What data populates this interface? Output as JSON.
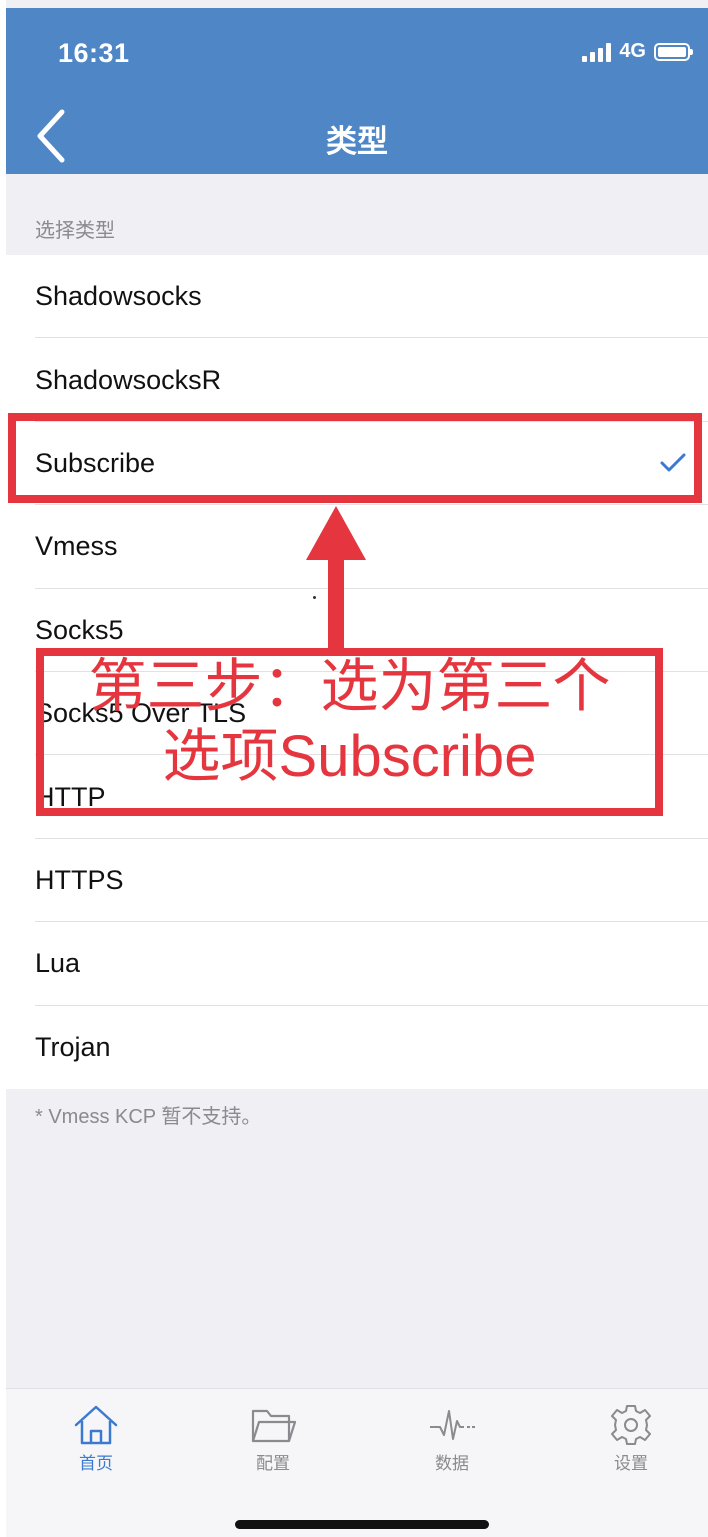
{
  "status_bar": {
    "time": "16:31",
    "network": "4G"
  },
  "nav": {
    "title": "类型"
  },
  "section": {
    "header": "选择类型"
  },
  "types": [
    {
      "label": "Shadowsocks"
    },
    {
      "label": "ShadowsocksR"
    },
    {
      "label": "Subscribe",
      "selected": true
    },
    {
      "label": "Vmess"
    },
    {
      "label": "Socks5"
    },
    {
      "label": "Socks5 Over TLS"
    },
    {
      "label": "HTTP"
    },
    {
      "label": "HTTPS"
    },
    {
      "label": "Lua"
    },
    {
      "label": "Trojan"
    }
  ],
  "footnote": "* Vmess KCP 暂不支持。",
  "tabbar": {
    "items": [
      {
        "label": "首页",
        "icon": "home-icon",
        "active": true
      },
      {
        "label": "配置",
        "icon": "folder-icon",
        "active": false
      },
      {
        "label": "数据",
        "icon": "pulse-icon",
        "active": false
      },
      {
        "label": "设置",
        "icon": "gear-icon",
        "active": false
      }
    ]
  },
  "annotation": {
    "line1": "第三步：选为第三个",
    "line2": "选项Subscribe",
    "color": "#e5363f"
  },
  "colors": {
    "header": "#4f86c6",
    "accent": "#3b7ad0",
    "background": "#efeff4"
  }
}
